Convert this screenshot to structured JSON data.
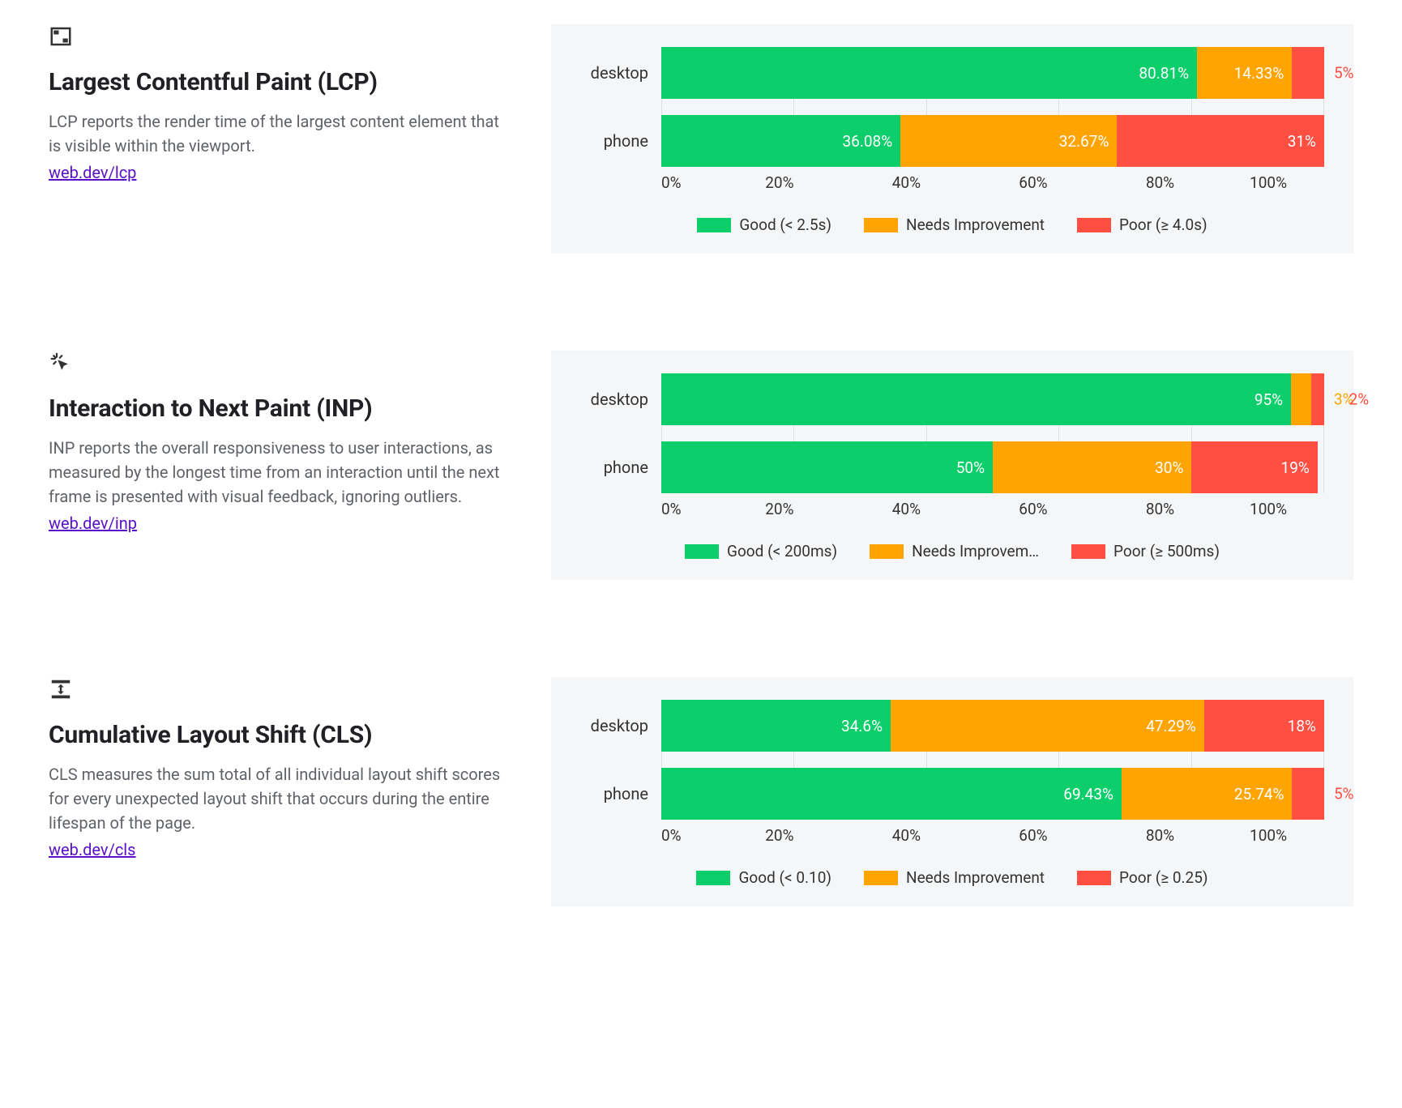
{
  "colors": {
    "good": "#0cce6b",
    "need": "#ffa400",
    "poor": "#ff4e42"
  },
  "axis_ticks": [
    "0%",
    "20%",
    "40%",
    "60%",
    "80%",
    "100%"
  ],
  "metrics": [
    {
      "id": "lcp",
      "title": "Largest Contentful Paint (LCP)",
      "desc": "LCP reports the render time of the largest content element that is visible within the viewport.",
      "link": "web.dev/lcp",
      "legend": {
        "good": "Good (< 2.5s)",
        "need": "Needs Improvement",
        "poor": "Poor (≥ 4.0s)"
      }
    },
    {
      "id": "inp",
      "title": "Interaction to Next Paint (INP)",
      "desc": "INP reports the overall responsiveness to user interactions, as measured by the longest time from an interaction until the next frame is presented with visual feedback, ignoring outliers.",
      "link": "web.dev/inp",
      "legend": {
        "good": "Good (< 200ms)",
        "need": "Needs Improvem…",
        "poor": "Poor (≥ 500ms)"
      }
    },
    {
      "id": "cls",
      "title": "Cumulative Layout Shift (CLS)",
      "desc": "CLS measures the sum total of all individual layout shift scores for every unexpected layout shift that occurs during the entire lifespan of the page.",
      "link": "web.dev/cls",
      "legend": {
        "good": "Good (< 0.10)",
        "need": "Needs Improvement",
        "poor": "Poor (≥ 0.25)"
      }
    }
  ],
  "chart_data": [
    {
      "metric": "lcp",
      "type": "bar",
      "orientation": "horizontal-stacked",
      "xlabel": "",
      "ylabel": "",
      "xlim": [
        0,
        100
      ],
      "categories": [
        "desktop",
        "phone"
      ],
      "series": [
        {
          "name": "Good (< 2.5s)",
          "values": [
            80.81,
            36.08
          ],
          "labels": [
            "80.81%",
            "36.08%"
          ],
          "label_pos": [
            "inside",
            "inside"
          ]
        },
        {
          "name": "Needs Improvement",
          "values": [
            14.33,
            32.67
          ],
          "labels": [
            "14.33%",
            "32.67%"
          ],
          "label_pos": [
            "inside",
            "inside"
          ]
        },
        {
          "name": "Poor (≥ 4.0s)",
          "values": [
            4.86,
            31.25
          ],
          "labels": [
            "5%",
            "31%"
          ],
          "label_pos": [
            "outside",
            "inside"
          ]
        }
      ]
    },
    {
      "metric": "inp",
      "type": "bar",
      "orientation": "horizontal-stacked",
      "xlabel": "",
      "ylabel": "",
      "xlim": [
        0,
        100
      ],
      "categories": [
        "desktop",
        "phone"
      ],
      "series": [
        {
          "name": "Good (< 200ms)",
          "values": [
            95,
            50
          ],
          "labels": [
            "95%",
            "50%"
          ],
          "label_pos": [
            "inside",
            "inside"
          ]
        },
        {
          "name": "Needs Improvement",
          "values": [
            3,
            30
          ],
          "labels": [
            "3%",
            "30%"
          ],
          "label_pos": [
            "outside",
            "inside"
          ]
        },
        {
          "name": "Poor (≥ 500ms)",
          "values": [
            2,
            19
          ],
          "labels": [
            "2%",
            "19%"
          ],
          "label_pos": [
            "outside",
            "inside"
          ]
        }
      ]
    },
    {
      "metric": "cls",
      "type": "bar",
      "orientation": "horizontal-stacked",
      "xlabel": "",
      "ylabel": "",
      "xlim": [
        0,
        100
      ],
      "categories": [
        "desktop",
        "phone"
      ],
      "series": [
        {
          "name": "Good (< 0.10)",
          "values": [
            34.6,
            69.43
          ],
          "labels": [
            "34.6%",
            "69.43%"
          ],
          "label_pos": [
            "inside",
            "inside"
          ]
        },
        {
          "name": "Needs Improvement",
          "values": [
            47.29,
            25.74
          ],
          "labels": [
            "47.29%",
            "25.74%"
          ],
          "label_pos": [
            "inside",
            "inside"
          ]
        },
        {
          "name": "Poor (≥ 0.25)",
          "values": [
            18.11,
            4.83
          ],
          "labels": [
            "18%",
            "5%"
          ],
          "label_pos": [
            "inside",
            "outside"
          ]
        }
      ]
    }
  ]
}
